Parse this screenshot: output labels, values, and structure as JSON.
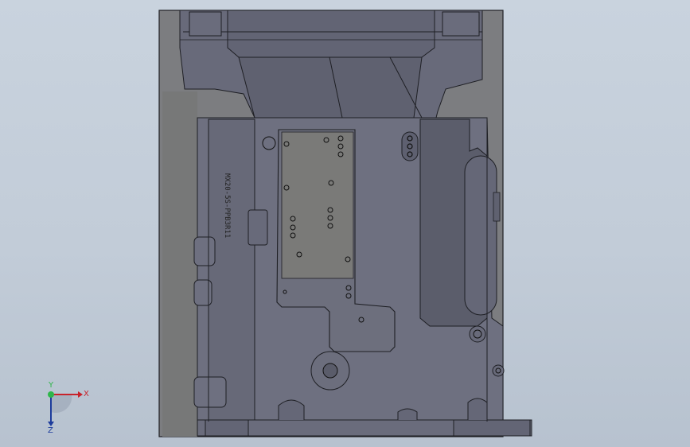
{
  "viewport": {
    "background_top": "#c9d3de",
    "background_bottom": "#b7c2cf"
  },
  "model": {
    "housing_color": "#7c7d80",
    "body_color": "#6e7080",
    "pocket_color": "#5b5d6b",
    "plate_color": "#7a7a78",
    "edge_color": "#1e1f24",
    "engraved_text": "MX20-5S-PPB3R11"
  },
  "triad": {
    "x_label": "X",
    "y_label": "Y",
    "z_label": "Z",
    "x_color": "#c8232b",
    "y_color": "#2fb64a",
    "z_color": "#1d3c9c"
  }
}
